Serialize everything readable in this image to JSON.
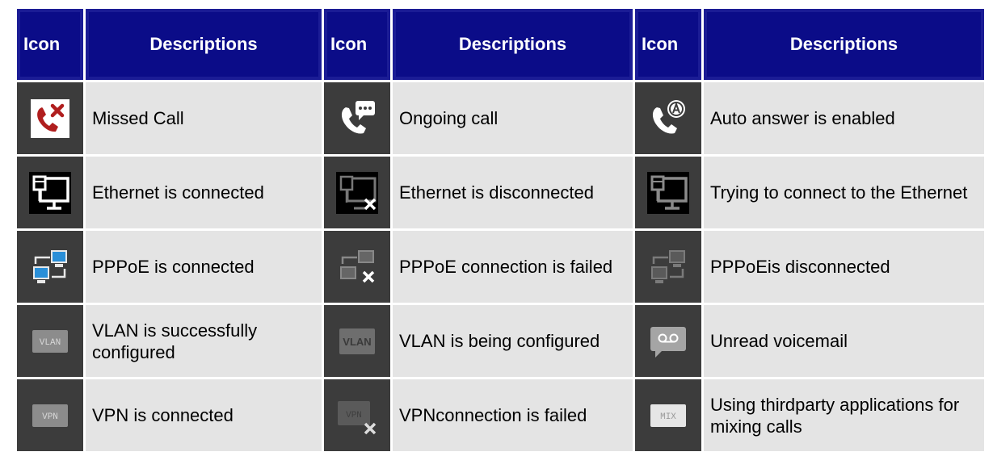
{
  "header": {
    "icon_label": "Icon",
    "desc_label": "Descriptions"
  },
  "rows": [
    [
      {
        "icon": "missed-call-icon",
        "desc": "Missed Call"
      },
      {
        "icon": "ongoing-call-icon",
        "desc": "Ongoing call"
      },
      {
        "icon": "auto-answer-icon",
        "desc": "Auto answer is enabled"
      }
    ],
    [
      {
        "icon": "ethernet-connected-icon",
        "desc": "Ethernet is connected"
      },
      {
        "icon": "ethernet-disconnected-icon",
        "desc": "Ethernet is disconnected"
      },
      {
        "icon": "ethernet-connecting-icon",
        "desc": "Trying to connect to the Ethernet"
      }
    ],
    [
      {
        "icon": "pppoe-connected-icon",
        "desc": "PPPoE is connected"
      },
      {
        "icon": "pppoe-failed-icon",
        "desc": "PPPoE connection is failed"
      },
      {
        "icon": "pppoe-disconnected-icon",
        "desc": "PPPoEis disconnected"
      }
    ],
    [
      {
        "icon": "vlan-configured-icon",
        "desc": "VLAN is successfully configured",
        "icon_text": "VLAN"
      },
      {
        "icon": "vlan-configuring-icon",
        "desc": "VLAN is being configured",
        "icon_text": "VLAN"
      },
      {
        "icon": "unread-voicemail-icon",
        "desc": "Unread voicemail"
      }
    ],
    [
      {
        "icon": "vpn-connected-icon",
        "desc": "VPN is connected",
        "icon_text": "VPN"
      },
      {
        "icon": "vpn-failed-icon",
        "desc": "VPNconnection is failed",
        "icon_text": "VPN"
      },
      {
        "icon": "mix-calls-icon",
        "desc": "Using thirdparty applications for mixing calls",
        "icon_text": "MIX"
      }
    ]
  ],
  "colors": {
    "header_bg": "#0b0c88",
    "icon_cell_bg": "#3c3c3c",
    "desc_cell_bg": "#e4e4e4",
    "missed_red": "#b01e1e",
    "pppoe_blue": "#2a8fd8"
  }
}
